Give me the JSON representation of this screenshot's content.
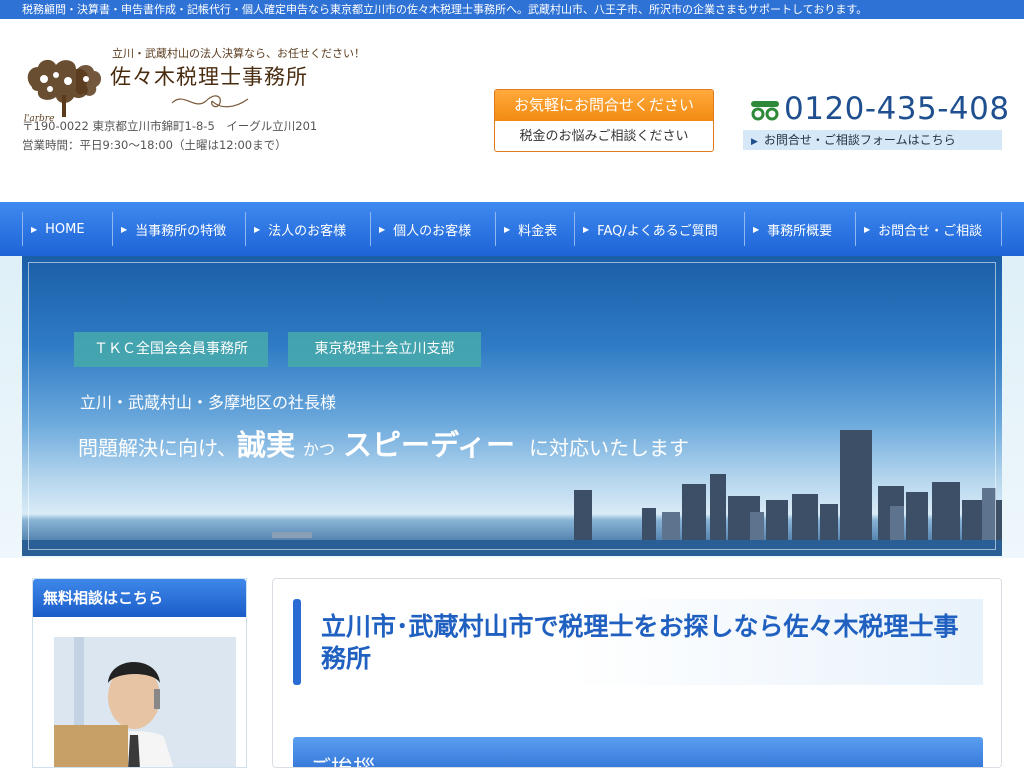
{
  "topbar": {
    "text": "税務顧問・決算書・申告書作成・記帳代行・個人確定申告なら東京都立川市の佐々木税理士事務所へ。武蔵村山市、八王子市、所沢市の企業さまもサポートしております。"
  },
  "header": {
    "tagline": "立川・武蔵村山の法人決算なら、お任せください！",
    "office_name": "佐々木税理士事務所",
    "logo_text": "l'arbre",
    "address_line": "〒190-0022 東京都立川市錦町1-8-5　イーグル立川201",
    "hours_line": "営業時間：平日9:30〜18:00（土曜は12:00まで）",
    "contact_top": "お気軽にお問合せください",
    "contact_bottom": "税金のお悩みご相談ください",
    "phone": "0120-435-408",
    "form_link": "お問合せ・ご相談フォームはこちら"
  },
  "nav": {
    "items": [
      {
        "label": "HOME"
      },
      {
        "label": "当事務所の特徴"
      },
      {
        "label": "法人のお客様"
      },
      {
        "label": "個人のお客様"
      },
      {
        "label": "料金表"
      },
      {
        "label": "FAQ/よくあるご質問"
      },
      {
        "label": "事務所概要"
      },
      {
        "label": "お問合せ・ご相談"
      }
    ]
  },
  "hero": {
    "badge1": "ＴＫＣ全国会会員事務所",
    "badge2": "東京税理士会立川支部",
    "subtitle": "立川・武蔵村山・多摩地区の社長様",
    "main_part1": "問題解決に向け、",
    "main_part2": "誠実",
    "main_part3": "かつ",
    "main_part4": "スピーディー",
    "main_part5": "に対応いたします"
  },
  "sidebar": {
    "heading": "無料相談はこちら"
  },
  "main": {
    "title": "立川市･武蔵村山市で税理士をお探しなら佐々木税理士事務所",
    "greeting": "ご挨拶"
  },
  "colors": {
    "primary_blue": "#2f72d6",
    "orange": "#f28a12",
    "brown": "#4a2d10"
  }
}
